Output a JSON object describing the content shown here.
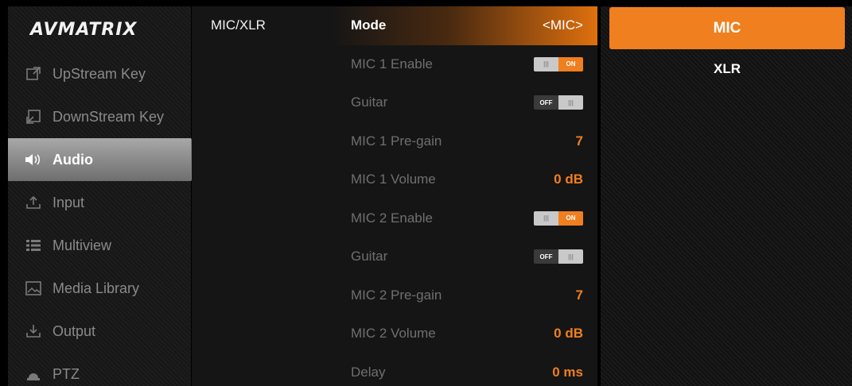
{
  "brand": "AVMATRIX",
  "sidebar": {
    "items": [
      {
        "label": "UpStream Key",
        "icon": "upstream-key-icon",
        "glyph": "↗"
      },
      {
        "label": "DownStream Key",
        "icon": "downstream-key-icon",
        "glyph": "↙"
      },
      {
        "label": "Audio",
        "icon": "speaker-icon",
        "glyph": "🔈"
      },
      {
        "label": "Input",
        "icon": "input-icon",
        "glyph": "↑"
      },
      {
        "label": "Multiview",
        "icon": "multiview-icon",
        "glyph": "☷"
      },
      {
        "label": "Media Library",
        "icon": "image-icon",
        "glyph": "▧"
      },
      {
        "label": "Output",
        "icon": "output-icon",
        "glyph": "↓"
      },
      {
        "label": "PTZ",
        "icon": "ptz-camera-icon",
        "glyph": "▲"
      }
    ],
    "active_index": 2
  },
  "section_label": "MIC/XLR",
  "settings": {
    "mode": {
      "label": "Mode",
      "value": "<MIC>"
    },
    "mic1_enable": {
      "label": "MIC 1 Enable",
      "state": "ON"
    },
    "mic1_guitar": {
      "label": "Guitar",
      "state": "OFF"
    },
    "mic1_pregain": {
      "label": "MIC 1 Pre-gain",
      "value": "7"
    },
    "mic1_volume": {
      "label": "MIC 1 Volume",
      "value": "0 dB"
    },
    "mic2_enable": {
      "label": "MIC 2 Enable",
      "state": "ON"
    },
    "mic2_guitar": {
      "label": "Guitar",
      "state": "OFF"
    },
    "mic2_pregain": {
      "label": "MIC 2 Pre-gain",
      "value": "7"
    },
    "mic2_volume": {
      "label": "MIC 2 Volume",
      "value": "0 dB"
    },
    "delay": {
      "label": "Delay",
      "value": "0 ms"
    }
  },
  "mode_options": {
    "selected": "MIC",
    "other": "XLR"
  },
  "colors": {
    "accent": "#f07f1f"
  }
}
